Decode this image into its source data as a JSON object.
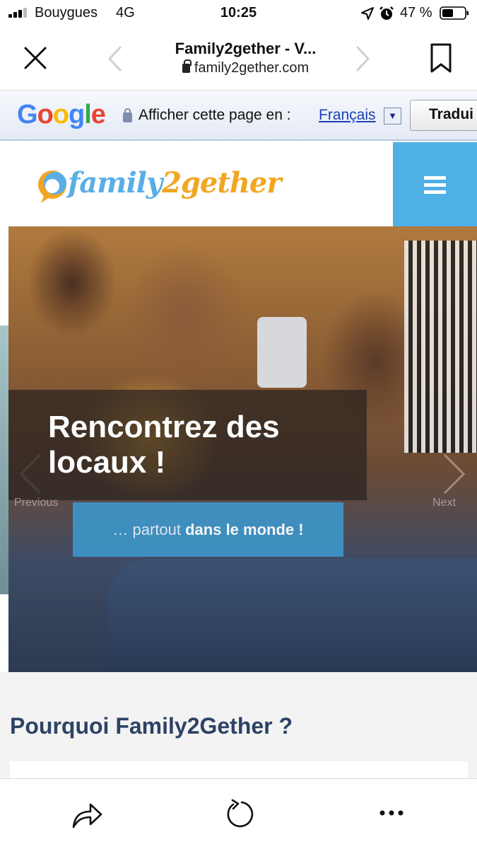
{
  "status_bar": {
    "carrier": "Bouygues",
    "network": "4G",
    "time": "10:25",
    "battery": "47 %"
  },
  "browser": {
    "page_title": "Family2gether - V...",
    "url": "family2gether.com",
    "icons": [
      "close-icon",
      "back-icon",
      "forward-icon",
      "bookmark-icon",
      "share-icon",
      "reload-icon",
      "more-icon"
    ]
  },
  "translate_bar": {
    "logo": "Google",
    "label": "Afficher cette page en :",
    "language": "Français",
    "dropdown": "▼",
    "translate_button": "Tradui"
  },
  "site": {
    "brand_part1": "family",
    "brand_part2": "2gether",
    "menu_icon": "hamburger-icon",
    "accent_color": "#4eb0e5"
  },
  "hero": {
    "caption": "Rencontrez des locaux !",
    "prev_label": "Previous",
    "next_label": "Next",
    "subtitle_light": "… partout ",
    "subtitle_strong": "dans le monde !"
  },
  "section": {
    "title": "Pourquoi Family2Gether ?"
  }
}
